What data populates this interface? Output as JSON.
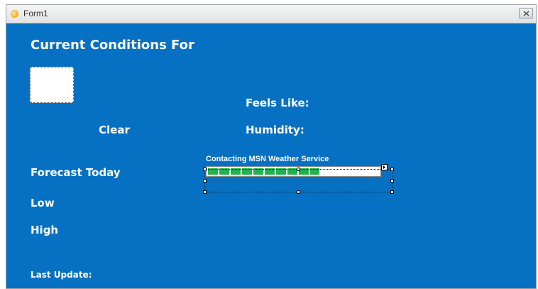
{
  "window": {
    "title": "Form1",
    "close_label": "close"
  },
  "form": {
    "heading": "Current Conditions For",
    "feels_like_label": "Feels Like:",
    "condition_text": "Clear",
    "humidity_label": "Humidity:",
    "forecast_label": "Forecast Today",
    "low_label": "Low",
    "high_label": "High",
    "last_update_label": "Last Update:"
  },
  "progress": {
    "status_text": "Contacting MSN Weather Service",
    "value_percent": 65,
    "fill_color": "#22b14c"
  },
  "colors": {
    "form_background": "#0671c2",
    "label_text": "#ffffff"
  },
  "icons": {
    "app": "form-app-icon",
    "close": "close-icon",
    "smart_tag": "smart-tag-arrow-icon"
  }
}
